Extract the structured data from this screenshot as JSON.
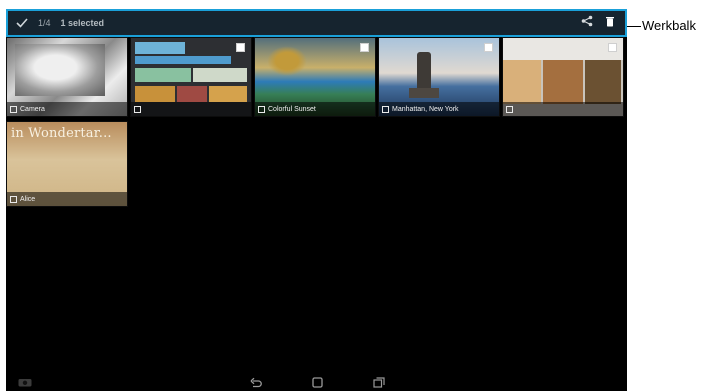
{
  "toolbar": {
    "select_count": "1/4",
    "selected_label": "1 selected",
    "icons": {
      "share": "share-icon",
      "delete": "trash-icon"
    }
  },
  "gallery": {
    "items": [
      {
        "caption": "Camera"
      },
      {
        "caption": ""
      },
      {
        "caption": "Colorful Sunset"
      },
      {
        "caption": "Manhattan, New York"
      },
      {
        "caption": ""
      },
      {
        "caption": "Alice",
        "heading": "in Wondertar..."
      }
    ]
  },
  "navbar": {
    "icons": [
      "camera-icon",
      "back-icon",
      "home-icon",
      "recent-apps-icon"
    ]
  },
  "annotation": {
    "label": "Werkbalk"
  }
}
